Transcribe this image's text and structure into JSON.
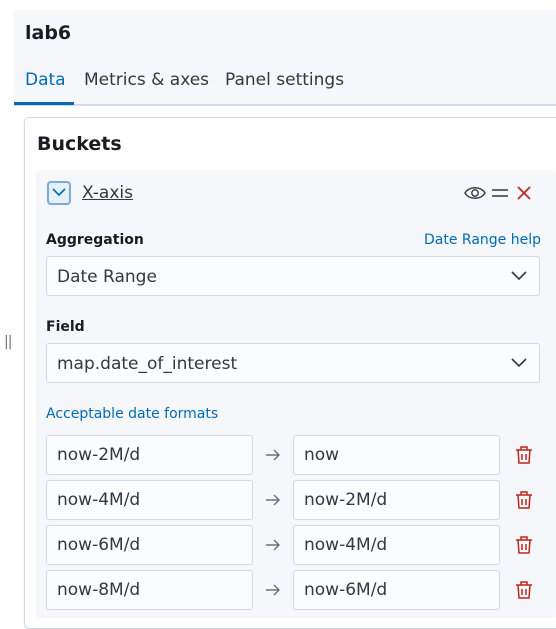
{
  "header": {
    "title": "lab6"
  },
  "tabs": [
    {
      "label": "Data",
      "active": true
    },
    {
      "label": "Metrics & axes",
      "active": false
    },
    {
      "label": "Panel settings",
      "active": false
    }
  ],
  "panel": {
    "title": "Buckets"
  },
  "aggregation_item": {
    "title": "X-axis",
    "aggregation_label": "Aggregation",
    "aggregation_help_link": "Date Range help",
    "aggregation_value": "Date Range",
    "field_label": "Field",
    "field_value": "map.date_of_interest",
    "date_formats_link": "Acceptable date formats",
    "ranges": [
      {
        "from": "now-2M/d",
        "to": "now"
      },
      {
        "from": "now-4M/d",
        "to": "now-2M/d"
      },
      {
        "from": "now-6M/d",
        "to": "now-4M/d"
      },
      {
        "from": "now-8M/d",
        "to": "now-6M/d"
      }
    ]
  },
  "colors": {
    "accent": "#006bb4",
    "danger": "#bd271e",
    "background": "#f5f7fa",
    "border": "#d3dae6"
  },
  "icons": [
    "chevron-down-icon",
    "eye-icon",
    "drag-handle-icon",
    "close-icon",
    "arrow-right-icon",
    "trash-icon",
    "resize-handle-icon"
  ]
}
